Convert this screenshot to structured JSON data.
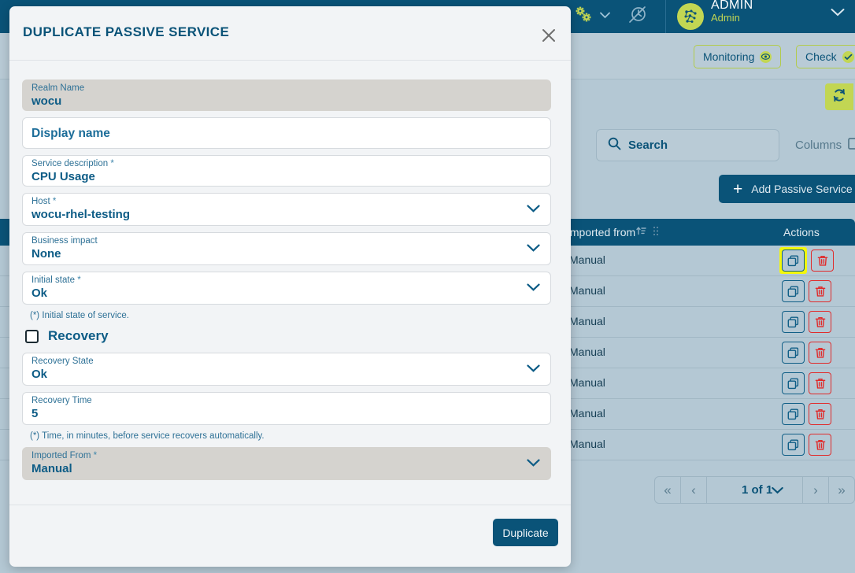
{
  "background": {
    "topbar": {
      "gears_icon": "gears-icon",
      "gears_caret_icon": "chevron-down-icon",
      "history_icon": "history-clock-icon",
      "avatar_icon": "avatar-icon",
      "user_name": "ADMIN",
      "user_role": "Admin",
      "user_caret_icon": "chevron-down-icon"
    },
    "subbar": {
      "monitoring_label": "Monitoring",
      "monitoring_icon": "eye-icon",
      "check_label": "Check",
      "check_icon": "check-circle-icon"
    },
    "refresh_icon": "refresh-icon",
    "search": {
      "icon": "search-icon",
      "label": "Search"
    },
    "columns": {
      "label": "Columns",
      "icon": "columns-icon"
    },
    "add_button": {
      "label": "Add Passive Service",
      "icon": "plus-icon"
    },
    "table": {
      "header_imported_from": "Imported from",
      "header_sort_icon": "sort-icon",
      "header_grip_icon": "drag-grip-icon",
      "header_actions": "Actions",
      "rows": [
        {
          "imported_from": "Manual",
          "duplicate_icon": "duplicate-icon",
          "delete_icon": "trash-icon",
          "highlighted": true
        },
        {
          "imported_from": "Manual",
          "duplicate_icon": "duplicate-icon",
          "delete_icon": "trash-icon",
          "highlighted": false
        },
        {
          "imported_from": "Manual",
          "duplicate_icon": "duplicate-icon",
          "delete_icon": "trash-icon",
          "highlighted": false
        },
        {
          "imported_from": "Manual",
          "duplicate_icon": "duplicate-icon",
          "delete_icon": "trash-icon",
          "highlighted": false
        },
        {
          "imported_from": "Manual",
          "duplicate_icon": "duplicate-icon",
          "delete_icon": "trash-icon",
          "highlighted": false
        },
        {
          "imported_from": "Manual",
          "duplicate_icon": "duplicate-icon",
          "delete_icon": "trash-icon",
          "highlighted": false
        },
        {
          "imported_from": "Manual",
          "duplicate_icon": "duplicate-icon",
          "delete_icon": "trash-icon",
          "highlighted": false
        }
      ]
    },
    "paginator": {
      "first_icon": "«",
      "prev_icon": "‹",
      "page_label": "1 of 1",
      "caret_icon": "chevron-down-icon",
      "next_icon": "›",
      "last_icon": "»"
    }
  },
  "modal": {
    "title": "DUPLICATE PASSIVE SERVICE",
    "close_icon": "close-icon",
    "fields": {
      "realm_name": {
        "label": "Realm Name",
        "value": "wocu",
        "required": false,
        "readonly": true
      },
      "display_name": {
        "placeholder": "Display name",
        "value": ""
      },
      "service_description": {
        "label": "Service description",
        "value": "CPU Usage",
        "required": true
      },
      "host": {
        "label": "Host",
        "value": "wocu-rhel-testing",
        "required": true,
        "caret_icon": "chevron-down-icon"
      },
      "business_impact": {
        "label": "Business impact",
        "value": "None",
        "required": false,
        "caret_icon": "chevron-down-icon"
      },
      "initial_state": {
        "label": "Initial state",
        "value": "Ok",
        "required": true,
        "caret_icon": "chevron-down-icon"
      },
      "recovery_state": {
        "label": "Recovery State",
        "value": "Ok",
        "required": false,
        "caret_icon": "chevron-down-icon"
      },
      "recovery_time": {
        "label": "Recovery Time",
        "value": "5",
        "required": false
      },
      "imported_from": {
        "label": "Imported From",
        "value": "Manual",
        "required": true,
        "readonly": true,
        "caret_icon": "chevron-down-icon"
      }
    },
    "hints": {
      "initial_state": "(*) Initial state of service.",
      "recovery_time": "(*) Time, in minutes, before service recovers automatically."
    },
    "recovery_section": {
      "label": "Recovery",
      "checked": false
    },
    "footer": {
      "duplicate_label": "Duplicate"
    }
  },
  "colors": {
    "brand_dark_blue": "#0a5378",
    "brand_green": "#c2d653",
    "page_bg": "#b4c8d4",
    "modal_bg": "#f2f4f6",
    "danger_red": "#e02b2b",
    "highlight_yellow": "#f2f70c",
    "readonly_field": "#d5d3cf"
  }
}
